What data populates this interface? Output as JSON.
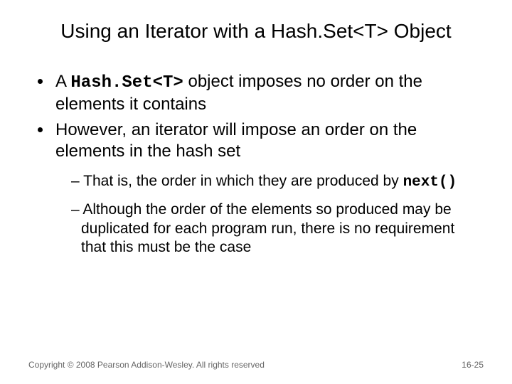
{
  "title": "Using an Iterator with a Hash.Set<T> Object",
  "b1a": "A ",
  "b1code": "Hash.Set<T>",
  "b1b": " object imposes no order on the elements it contains",
  "b2": "However, an iterator will impose an order on the elements in the hash set",
  "s1a": "That is, the order in which they are produced by ",
  "s1code": "next()",
  "s2": "Although the order of the elements so produced may be duplicated for each program run, there is no requirement that this must be the case",
  "copyright": "Copyright © 2008 Pearson Addison-Wesley. All rights reserved",
  "page": "16-25"
}
